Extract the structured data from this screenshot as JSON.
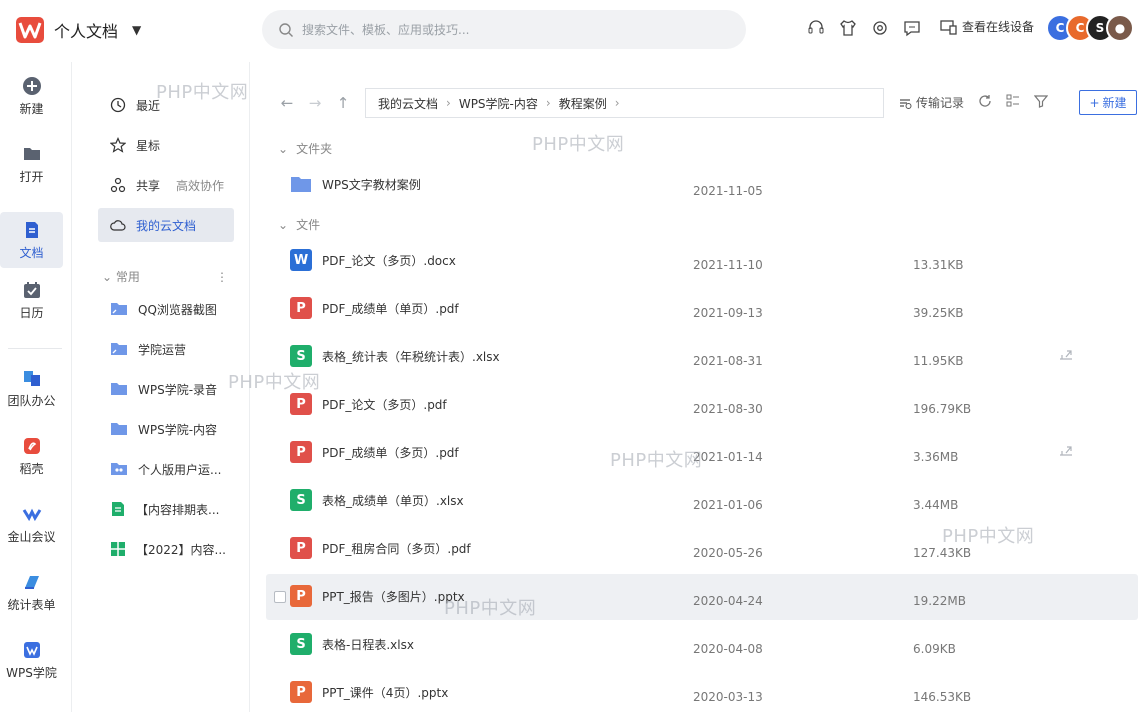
{
  "app": {
    "title": "个人文档"
  },
  "search": {
    "placeholder": "搜索文件、模板、应用或技巧..."
  },
  "header": {
    "device_label": "查看在线设备"
  },
  "rail": [
    {
      "label": "新建",
      "icon": "plus-circle-icon"
    },
    {
      "label": "打开",
      "icon": "folder-open-icon"
    },
    {
      "label": "文档",
      "icon": "document-icon",
      "active": true
    },
    {
      "label": "日历",
      "icon": "calendar-icon"
    },
    {
      "label": "团队办公",
      "icon": "team-icon"
    },
    {
      "label": "稻壳",
      "icon": "docer-icon"
    },
    {
      "label": "金山会议",
      "icon": "meeting-icon"
    },
    {
      "label": "统计表单",
      "icon": "form-icon"
    },
    {
      "label": "WPS学院",
      "icon": "academy-icon"
    }
  ],
  "sidebar": {
    "items": [
      {
        "label": "最近",
        "icon": "clock-icon"
      },
      {
        "label": "星标",
        "icon": "star-icon"
      },
      {
        "label": "共享",
        "icon": "share-icon",
        "sub": "高效协作"
      },
      {
        "label": "我的云文档",
        "icon": "cloud-icon",
        "active": true
      }
    ],
    "section_title": "常用",
    "favorites": [
      {
        "label": "QQ浏览器截图",
        "icon": "folder-link-icon"
      },
      {
        "label": "学院运营",
        "icon": "folder-link-icon"
      },
      {
        "label": "WPS学院-录音",
        "icon": "folder-icon"
      },
      {
        "label": "WPS学院-内容",
        "icon": "folder-icon"
      },
      {
        "label": "个人版用户运...",
        "icon": "team-folder-icon"
      },
      {
        "label": "【内容排期表...",
        "icon": "sheet-doc-icon"
      },
      {
        "label": "【2022】内容...",
        "icon": "sheet-grid-icon"
      }
    ]
  },
  "breadcrumb": [
    "我的云文档",
    "WPS学院-内容",
    "教程案例"
  ],
  "toolbar": {
    "transfer_label": "传输记录",
    "new_label": "新建"
  },
  "groups": {
    "folders": "文件夹",
    "files": "文件"
  },
  "folders": [
    {
      "name": "WPS文字教材案例",
      "date": "2021-11-05"
    }
  ],
  "files": [
    {
      "name": "PDF_论文（多页）.docx",
      "date": "2021-11-10",
      "size": "13.31KB",
      "type": "word",
      "shared": false
    },
    {
      "name": "PDF_成绩单（单页）.pdf",
      "date": "2021-09-13",
      "size": "39.25KB",
      "type": "pdf",
      "shared": false
    },
    {
      "name": "表格_统计表（年税统计表）.xlsx",
      "date": "2021-08-31",
      "size": "11.95KB",
      "type": "sheet",
      "shared": true
    },
    {
      "name": "PDF_论文（多页）.pdf",
      "date": "2021-08-30",
      "size": "196.79KB",
      "type": "pdf",
      "shared": false
    },
    {
      "name": "PDF_成绩单（多页）.pdf",
      "date": "2021-01-14",
      "size": "3.36MB",
      "type": "pdf",
      "shared": true
    },
    {
      "name": "表格_成绩单（单页）.xlsx",
      "date": "2021-01-06",
      "size": "3.44MB",
      "type": "sheet",
      "shared": false
    },
    {
      "name": "PDF_租房合同（多页）.pdf",
      "date": "2020-05-26",
      "size": "127.43KB",
      "type": "pdf",
      "shared": false
    },
    {
      "name": "PPT_报告（多图片）.pptx",
      "date": "2020-04-24",
      "size": "19.22MB",
      "type": "ppt",
      "shared": false,
      "hover": true
    },
    {
      "name": "表格-日程表.xlsx",
      "date": "2020-04-08",
      "size": "6.09KB",
      "type": "sheet",
      "shared": false
    },
    {
      "name": "PPT_课件（4页）.pptx",
      "date": "2020-03-13",
      "size": "146.53KB",
      "type": "ppt",
      "shared": false
    }
  ],
  "watermark": "PHP中文网",
  "colors": {
    "accent": "#3b6fe0",
    "word": "#2b6fd6",
    "pdf": "#e0504a",
    "sheet": "#1fae6b",
    "ppt": "#e8683a",
    "folder": "#6f97e8"
  }
}
